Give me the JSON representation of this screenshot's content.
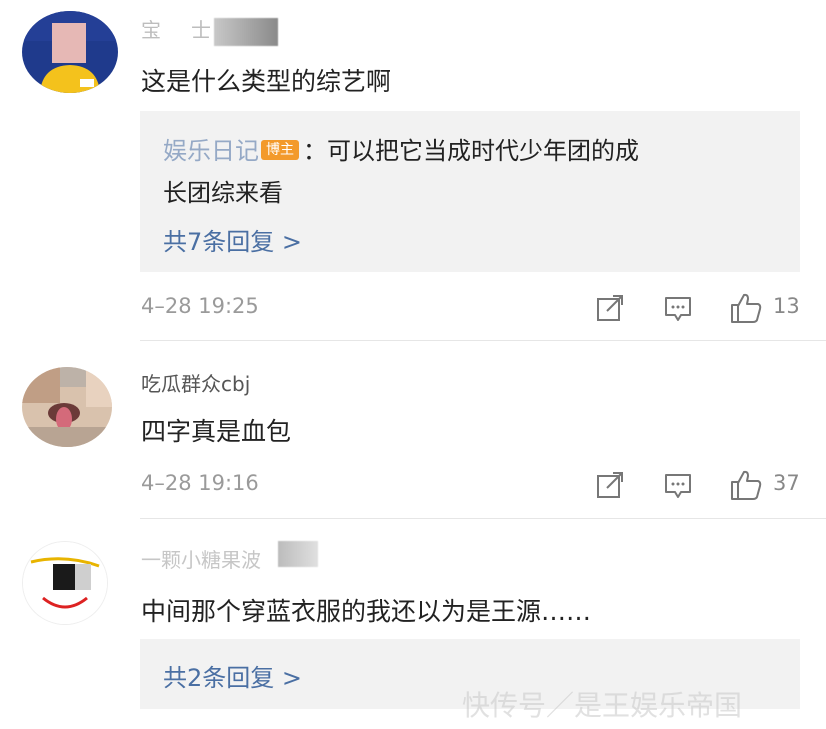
{
  "colors": {
    "link": "#4a6fa3",
    "badge": "#f39a2b",
    "meta": "#9a9a9a",
    "reply_bg": "#f2f2f2"
  },
  "comments": [
    {
      "username": "宝士",
      "text": "这是什么类型的综艺啊",
      "reply": {
        "author": "娱乐日记",
        "badge": "博主",
        "content_line1": "：可以把它当成时代少年团的成",
        "content_line2": "长团综来看"
      },
      "more_replies": "共7条回复 >",
      "time": "4–28 19:25",
      "likes": "13"
    },
    {
      "username": "吃瓜群众cbj",
      "text": "四字真是血包",
      "time": "4–28 19:16",
      "likes": "37"
    },
    {
      "username": "一颗小糖果波",
      "text": "中间那个穿蓝衣服的我还以为是王源……",
      "more_replies": "共2条回复 >"
    }
  ],
  "watermark": "快传号／是王娱乐帝国"
}
